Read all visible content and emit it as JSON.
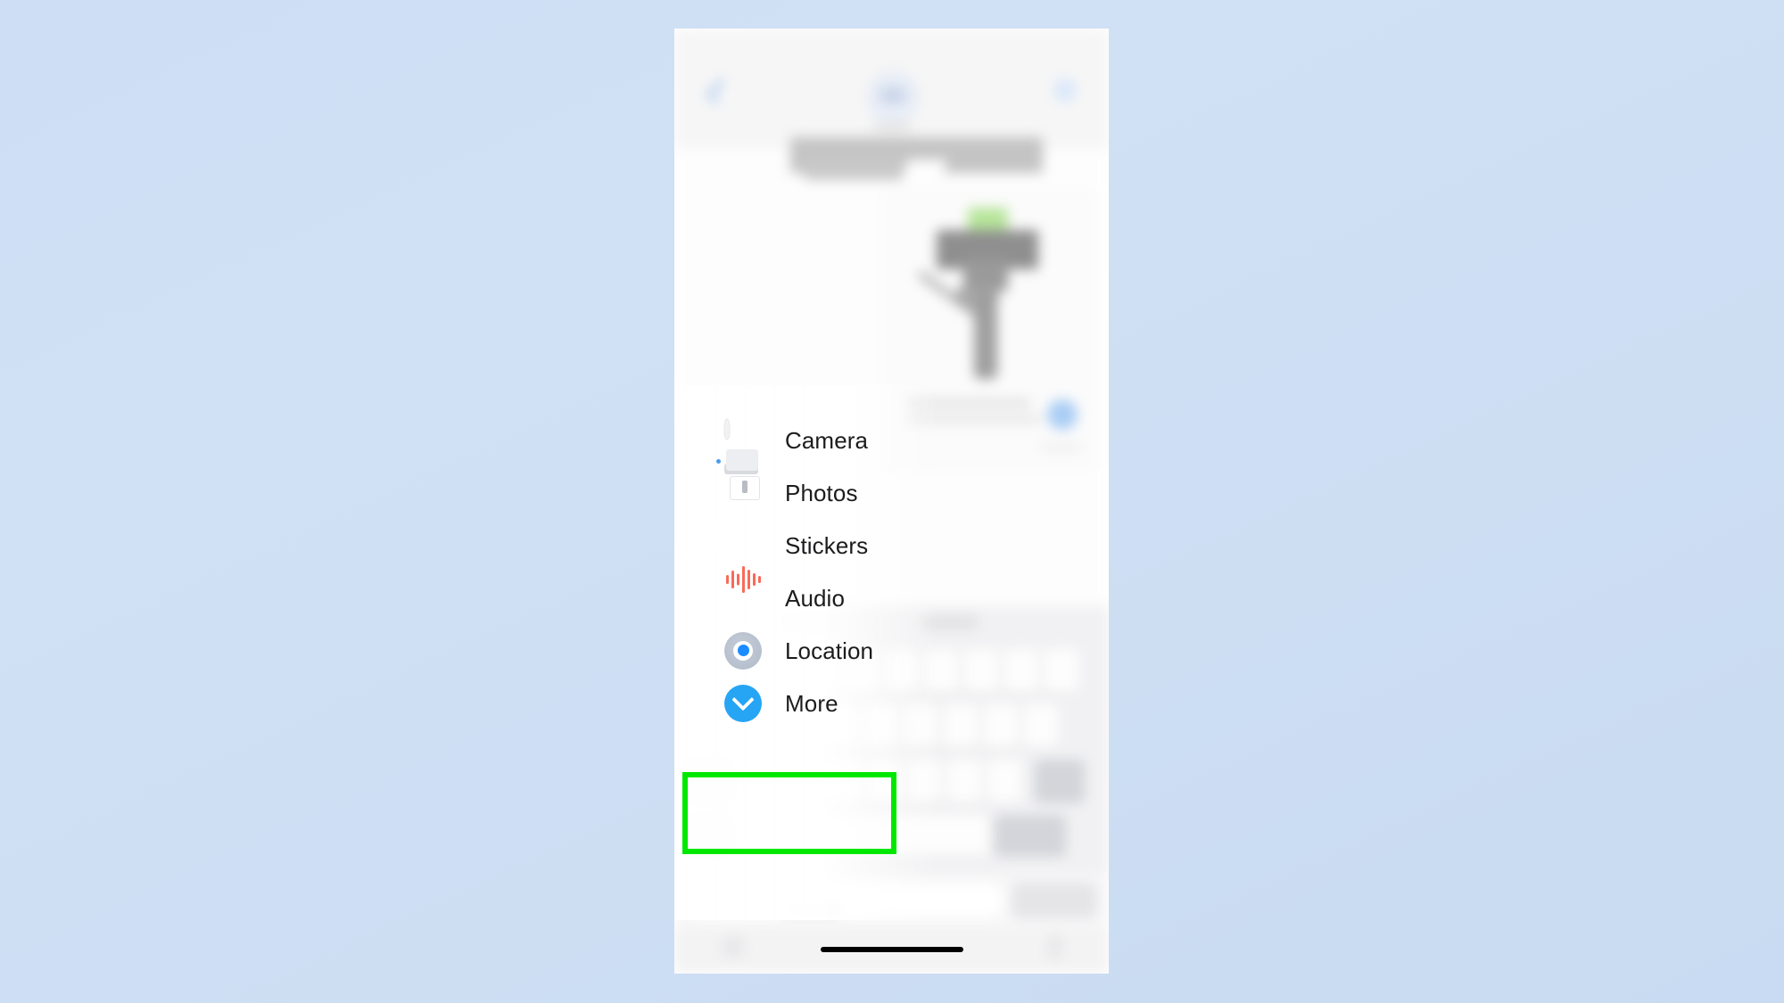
{
  "background": {
    "color_top": "#cedff5",
    "color_bottom": "#c8dbf2"
  },
  "device": {
    "platform": "iOS",
    "home_indicator": true
  },
  "chat_header": {
    "back_icon": "chevron-left-icon",
    "avatar": "contact-avatar",
    "info_icon": "info-icon",
    "contact_name_redacted": true
  },
  "conversation": {
    "redacted_sender_name": true,
    "message_attachment": "image-thumbnail",
    "blurred": true
  },
  "attachment_menu": {
    "items": [
      {
        "label": "Camera",
        "icon": "camera-icon",
        "accent": "#9a9a9e"
      },
      {
        "label": "Photos",
        "icon": "photos-icon",
        "accent": "#4a9bf0"
      },
      {
        "label": "Stickers",
        "icon": "stickers-icon",
        "accent": "#9a8cf2"
      },
      {
        "label": "Audio",
        "icon": "audio-icon",
        "accent": "#f86a5a"
      },
      {
        "label": "Location",
        "icon": "location-icon",
        "accent": "#1a8cff"
      },
      {
        "label": "More",
        "icon": "more-icon",
        "accent": "#26a5f5"
      }
    ]
  },
  "annotation": {
    "highlight_color": "#00e800",
    "highlighted_item": "Location",
    "shape": "rectangle",
    "border_width_px": 6
  },
  "keyboard": {
    "visible": true,
    "blurred": true
  },
  "input_bar": {
    "placeholder_redacted": true,
    "send_button_redacted": true
  }
}
